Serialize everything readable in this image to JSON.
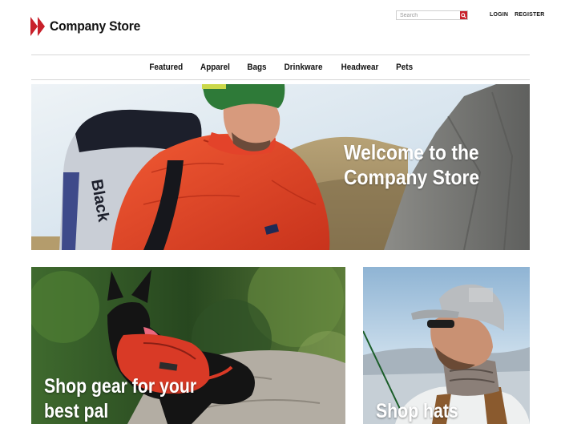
{
  "brand": {
    "name": "Company Store",
    "accent": "#c8202a"
  },
  "search": {
    "placeholder": "Search",
    "icon": "search-icon"
  },
  "account": {
    "login": "LOGIN",
    "register": "REGISTER"
  },
  "nav": {
    "items": [
      "Featured",
      "Apparel",
      "Bags",
      "Drinkware",
      "Headwear",
      "Pets"
    ]
  },
  "hero": {
    "title": "Welcome to the Company Store",
    "backpack_text": "Black"
  },
  "tiles": {
    "pets": {
      "title": "Shop gear for your best pal"
    },
    "hats": {
      "title": "Shop hats"
    }
  }
}
